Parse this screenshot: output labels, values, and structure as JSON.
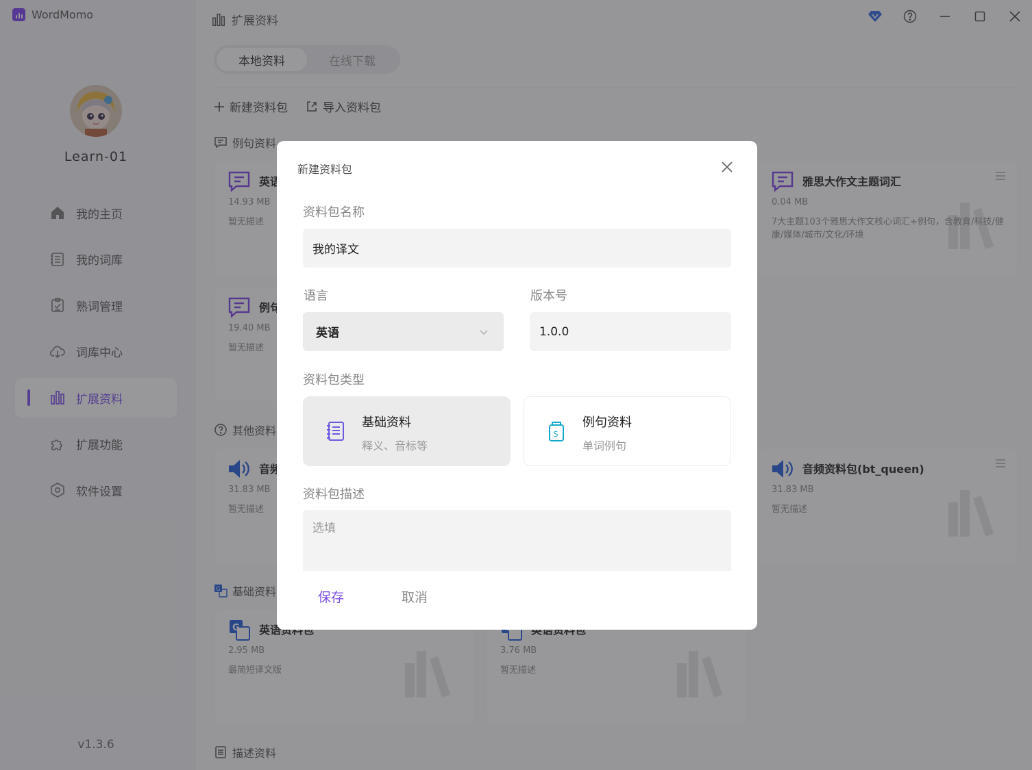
{
  "app": {
    "name": "WordMomo",
    "version": "v1.3.6"
  },
  "user": {
    "name": "Learn-01"
  },
  "nav": [
    {
      "label": "我的主页",
      "icon": "home-icon"
    },
    {
      "label": "我的词库",
      "icon": "book-list-icon"
    },
    {
      "label": "熟词管理",
      "icon": "clipboard-check-icon"
    },
    {
      "label": "词库中心",
      "icon": "cloud-download-icon"
    },
    {
      "label": "扩展资料",
      "icon": "bar-chart-icon",
      "active": true
    },
    {
      "label": "扩展功能",
      "icon": "puzzle-icon"
    },
    {
      "label": "软件设置",
      "icon": "settings-hexagon-icon"
    }
  ],
  "page": {
    "title": "扩展资料",
    "tabs": [
      {
        "label": "本地资料",
        "active": true
      },
      {
        "label": "在线下载"
      }
    ],
    "toolbar": {
      "new_label": "新建资料包",
      "import_label": "导入资料包"
    },
    "sections": {
      "example": "例句资料",
      "other": "其他资料",
      "basic": "基础资料",
      "desc": "描述资料"
    },
    "cards": {
      "ex1": {
        "title": "英语",
        "size": "14.93 MB",
        "desc": "暂无描述"
      },
      "ex2": {
        "title": "例句",
        "size": "19.40 MB",
        "desc": "暂无描述"
      },
      "ex3": {
        "title": "雅思大作文主题词汇",
        "size": "0.04 MB",
        "desc": "7大主题103个雅思大作文核心词汇+例句，含教育/科技/健康/媒体/城市/文化/环境"
      },
      "ot1": {
        "title": "音频",
        "size": "31.83 MB",
        "desc": "暂无描述"
      },
      "ot3": {
        "title": "音频资料包(bt_queen)",
        "size": "31.83 MB",
        "desc": "暂无描述"
      },
      "ba1": {
        "title": "英语资料包",
        "size": "2.95 MB",
        "desc": "最简短译文版"
      },
      "ba2": {
        "title": "英语资料包",
        "size": "3.76 MB",
        "desc": "暂无描述"
      }
    }
  },
  "dialog": {
    "title": "新建资料包",
    "name_label": "资料包名称",
    "name_value": "我的译文",
    "lang_label": "语言",
    "lang_value": "英语",
    "version_label": "版本号",
    "version_value": "1.0.0",
    "type_label": "资料包类型",
    "types": [
      {
        "name": "基础资料",
        "sub": "释义、音标等",
        "selected": true
      },
      {
        "name": "例句资料",
        "sub": "单词例句"
      }
    ],
    "desc_label": "资料包描述",
    "desc_placeholder": "选填",
    "save_label": "保存",
    "cancel_label": "取消"
  },
  "colors": {
    "accent": "#7a4de8",
    "icon_purple": "#7b3fe4",
    "icon_blue": "#1e5bd8",
    "icon_teal": "#13a9c9"
  }
}
